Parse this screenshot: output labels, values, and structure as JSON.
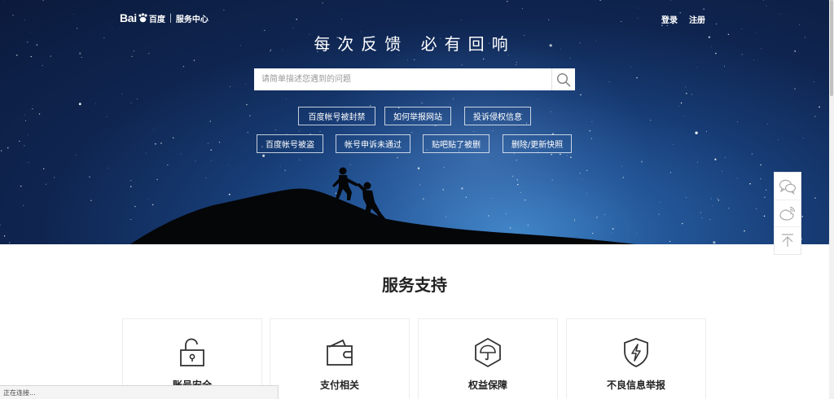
{
  "header": {
    "logo_text": "Bai",
    "logo_cn": "百度",
    "logo_sub": "服务中心",
    "login": "登录",
    "register": "注册"
  },
  "hero": {
    "slogan": "每次反馈 必有回响",
    "search_placeholder": "请简单描述您遇到的问题",
    "tags": [
      "百度帐号被封禁",
      "如何举报网站",
      "投诉侵权信息",
      "百度帐号被盗",
      "帐号申诉未通过",
      "贴吧贴了被删",
      "删除/更新快照"
    ]
  },
  "sidebar": {
    "icons": [
      "wechat-icon",
      "weibo-icon",
      "back-to-top-icon"
    ]
  },
  "services": {
    "title": "服务支持",
    "cards": [
      {
        "label": "账号安全",
        "icon": "lock-icon"
      },
      {
        "label": "支付相关",
        "icon": "wallet-icon"
      },
      {
        "label": "权益保障",
        "icon": "umbrella-icon"
      },
      {
        "label": "不良信息举报",
        "icon": "shield-bolt-icon"
      }
    ]
  },
  "status": "正在连接...",
  "colors": {
    "sky_dark": "#0b1a3c",
    "sky_light": "#3f86c8",
    "text_dark": "#222222"
  }
}
